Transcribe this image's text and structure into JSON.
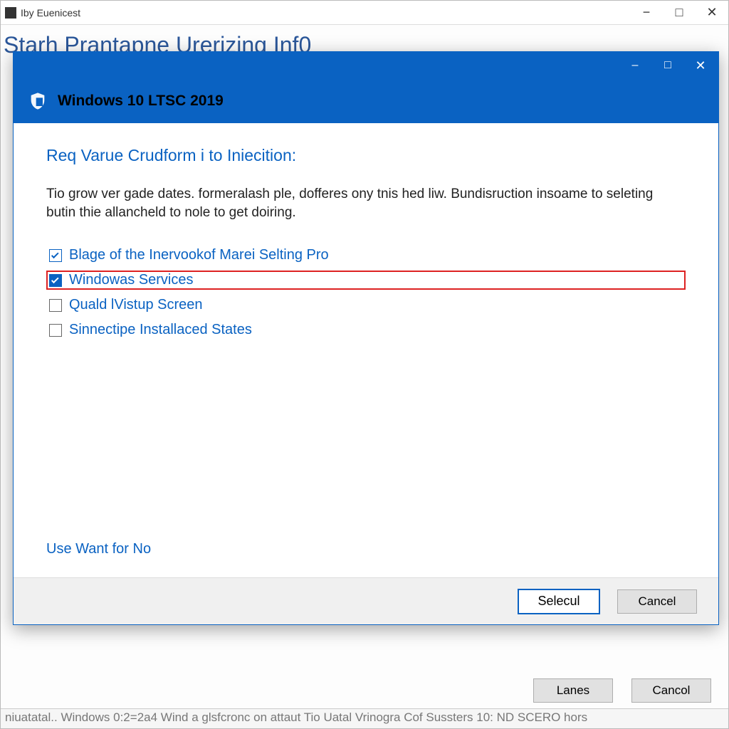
{
  "parent": {
    "app_title": "Iby Euenicest",
    "heading": "Starh Prantapne Urerizing Inf0",
    "buttons": {
      "lanes": "Lanes",
      "cancol": "Cancol"
    },
    "status": "niuatatal.. Windows 0:2=2a4 Wind a glsfcronc on attaut Tio Uatal Vrinogra Cof Sussters     10: ND SCERO hors"
  },
  "dialog": {
    "title": "Windows 10 LTSC 2019",
    "instruction": "Req Varue Crudform i to Iniecition:",
    "description": "Tio grow ver gade dates. formeralash ple, dofferes ony tnis hed liw. Bundisruction insoame to seleting butin thie allancheld to nole to get doiring.",
    "options": [
      {
        "label": "Blage of the Inervookof Marei Selting Pro",
        "checked": true,
        "style": "outline",
        "highlighted": false
      },
      {
        "label": "Windowas Services",
        "checked": true,
        "style": "filled",
        "highlighted": true
      },
      {
        "label": "Quald lVistup Screen",
        "checked": false,
        "style": "gray",
        "highlighted": false
      },
      {
        "label": "Sinnectipe Installaced States",
        "checked": false,
        "style": "gray",
        "highlighted": false
      }
    ],
    "link_text": "Use Want for No",
    "buttons": {
      "primary": "Selecul",
      "cancel": "Cancel"
    }
  },
  "colors": {
    "blue": "#0a62c2",
    "red_highlight": "#d22"
  }
}
